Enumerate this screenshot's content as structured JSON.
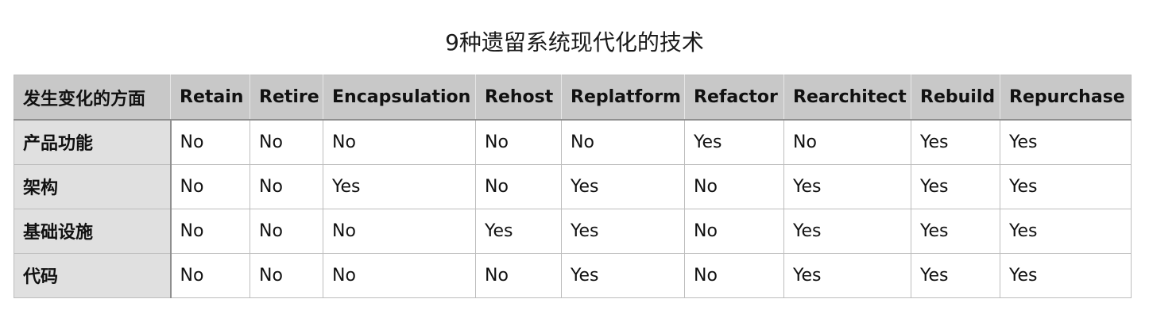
{
  "title": "9种遗留系统现代化的技术",
  "table": {
    "columns": [
      "发生变化的方面",
      "Retain",
      "Retire",
      "Encapsulation",
      "Rehost",
      "Replatform",
      "Refactor",
      "Rearchitect",
      "Rebuild",
      "Repurchase"
    ],
    "rows": [
      {
        "label": "产品功能",
        "cells": [
          "No",
          "No",
          "No",
          "No",
          "No",
          "Yes",
          "No",
          "Yes",
          "Yes"
        ]
      },
      {
        "label": "架构",
        "cells": [
          "No",
          "No",
          "Yes",
          "No",
          "Yes",
          "No",
          "Yes",
          "Yes",
          "Yes"
        ]
      },
      {
        "label": "基础设施",
        "cells": [
          "No",
          "No",
          "No",
          "Yes",
          "Yes",
          "No",
          "Yes",
          "Yes",
          "Yes"
        ]
      },
      {
        "label": "代码",
        "cells": [
          "No",
          "No",
          "No",
          "No",
          "Yes",
          "No",
          "Yes",
          "Yes",
          "Yes"
        ]
      }
    ]
  },
  "colors": {
    "header_bg": "#c8c8c8",
    "row_header_bg": "#e0e0e0",
    "border": "#bdbdbd"
  }
}
